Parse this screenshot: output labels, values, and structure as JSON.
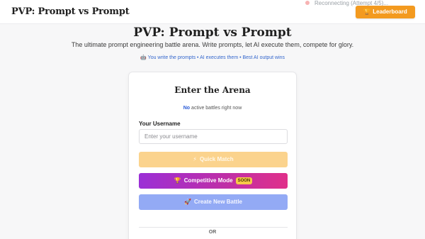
{
  "header": {
    "brand": "PVP: Prompt vs Prompt",
    "status_text": "Reconnecting (Attempt 4/5)...",
    "leaderboard_icon": "🏆",
    "leaderboard_label": "Leaderboard"
  },
  "hero": {
    "title": "PVP: Prompt vs Prompt",
    "subtitle": "The ultimate prompt engineering battle arena. Write prompts, let AI execute them, compete for glory.",
    "tags_icon": "🤖",
    "tags": "You write the prompts • AI executes them • Best AI output wins"
  },
  "arena": {
    "title": "Enter the Arena",
    "active_count": "No",
    "active_suffix": "active battles right now",
    "username_label": "Your Username",
    "username_placeholder": "Enter your username",
    "username_value": "",
    "quick_match_icon": "⚡",
    "quick_match_label": "Quick Match",
    "competitive_icon": "🏆",
    "competitive_label": "Competitive Mode",
    "competitive_badge": "SOON",
    "create_icon": "🚀",
    "create_label": "Create New Battle",
    "or_label": "OR"
  },
  "colors": {
    "accent_orange": "#f39a1f",
    "link_blue": "#3366cc",
    "quick_match_bg": "#fbd38d",
    "competitive_gradient_start": "#9b2fd6",
    "competitive_gradient_end": "#e0308a",
    "create_bg": "#93aaf5"
  }
}
